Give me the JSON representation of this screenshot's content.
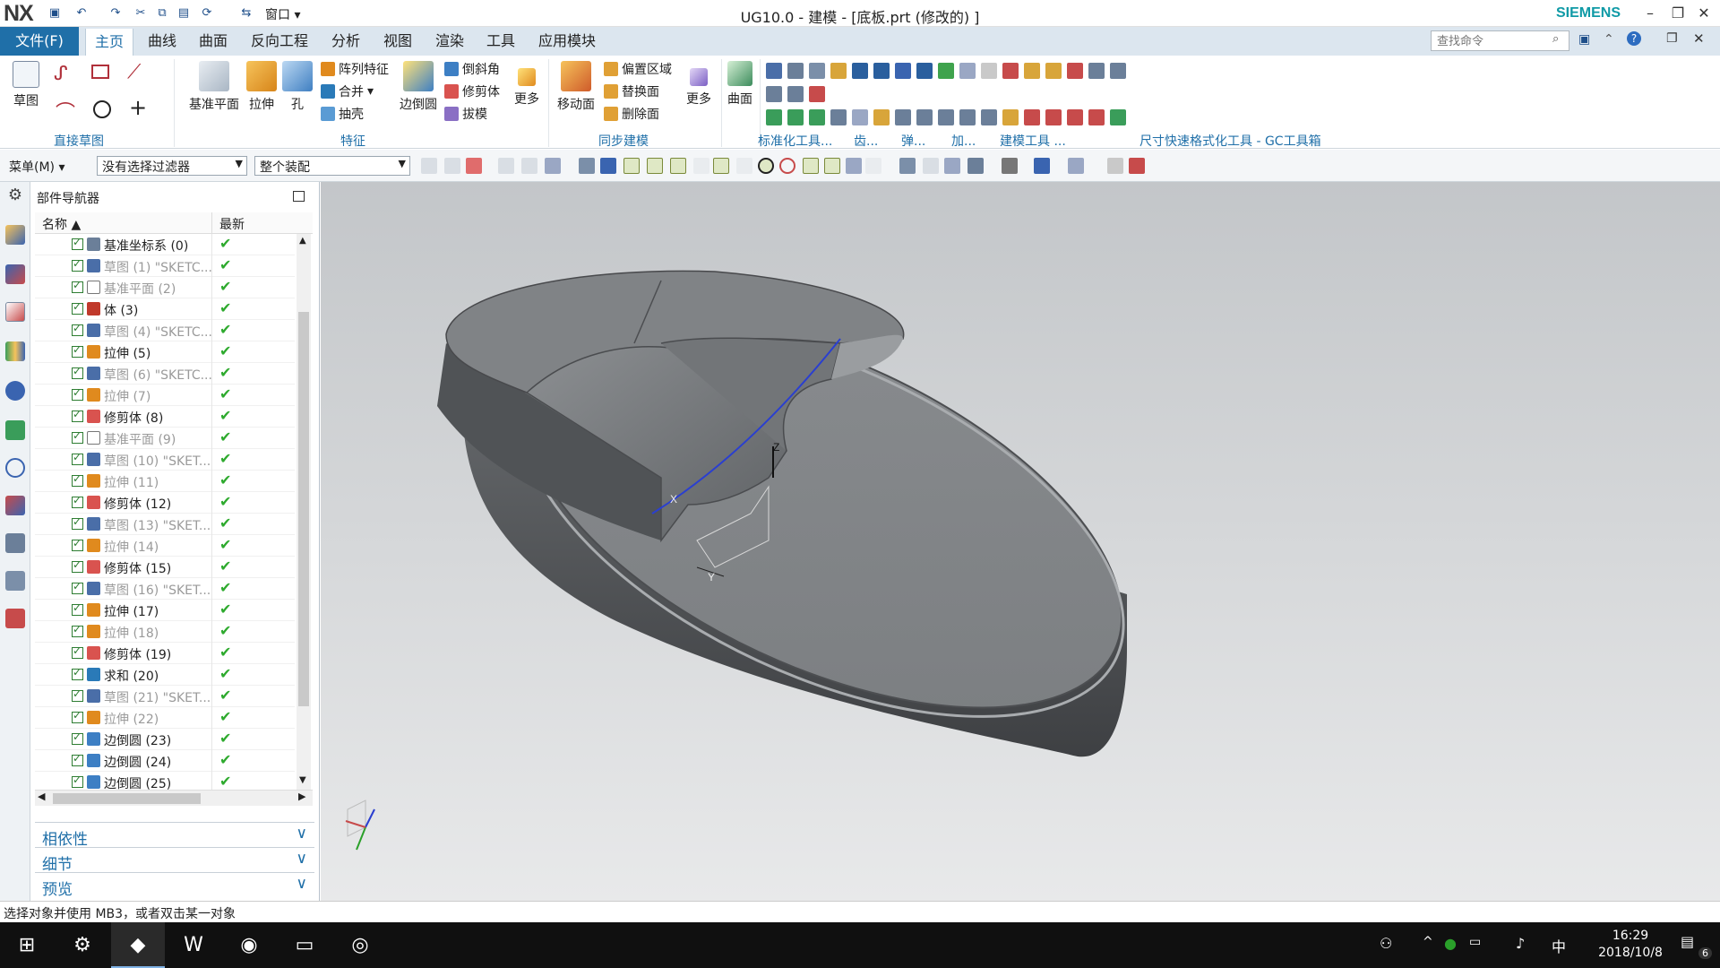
{
  "app": {
    "logo": "NX",
    "title": "UG10.0 - 建模 - [底板.prt  (修改的) ]",
    "brand": "SIEMENS",
    "window_menu": "窗口"
  },
  "ribbon_tabs": {
    "file": "文件(F)",
    "items": [
      "主页",
      "曲线",
      "曲面",
      "反向工程",
      "分析",
      "视图",
      "渲染",
      "工具",
      "应用模块"
    ],
    "search_placeholder": "查找命令"
  },
  "ribbon": {
    "sketch": "草图",
    "datum_plane": "基准平面",
    "extrude": "拉伸",
    "hole": "孔",
    "pattern_feature": "阵列特征",
    "unite": "合并",
    "shell": "抽壳",
    "edge_blend": "边倒圆",
    "chamfer": "倒斜角",
    "trim_body": "修剪体",
    "draft": "拔模",
    "more": "更多",
    "move_face": "移动面",
    "offset_region": "偏置区域",
    "replace_face": "替换面",
    "delete_face": "删除面",
    "more2": "更多",
    "surface": "曲面",
    "groups": {
      "direct_sketch": "直接草图",
      "feature": "特征",
      "sync_modeling": "同步建模",
      "standardization": "标准化工具...",
      "gear": "齿...",
      "spring": "弹...",
      "add": "加...",
      "modeling_tools": "建模工具 ...",
      "dim_tools": "尺寸快速格式化工具 - GC工具箱"
    }
  },
  "cmdbar": {
    "menu": "菜单(M)",
    "filter": "没有选择过滤器",
    "assembly": "整个装配"
  },
  "navigator": {
    "title": "部件导航器",
    "col_name": "名称",
    "col_latest": "最新",
    "items": [
      {
        "name": "基准坐标系 (0)",
        "dim": false,
        "icon": "datum-csys-icon",
        "color": "#6b7f99"
      },
      {
        "name": "草图 (1) \"SKETC...",
        "dim": true,
        "icon": "sketch-icon",
        "color": "#4a6ea8"
      },
      {
        "name": "基准平面 (2)",
        "dim": true,
        "icon": "datum-plane-icon",
        "color": "#ffffff"
      },
      {
        "name": "体 (3)",
        "dim": false,
        "icon": "body-icon",
        "color": "#c0392b"
      },
      {
        "name": "草图 (4) \"SKETC...",
        "dim": true,
        "icon": "sketch-icon",
        "color": "#4a6ea8"
      },
      {
        "name": "拉伸 (5)",
        "dim": false,
        "icon": "extrude-icon",
        "color": "#e08a1e"
      },
      {
        "name": "草图 (6) \"SKETC...",
        "dim": true,
        "icon": "sketch-icon",
        "color": "#4a6ea8"
      },
      {
        "name": "拉伸 (7)",
        "dim": true,
        "icon": "extrude-icon",
        "color": "#e08a1e"
      },
      {
        "name": "修剪体 (8)",
        "dim": false,
        "icon": "trim-body-icon",
        "color": "#d9534f"
      },
      {
        "name": "基准平面 (9)",
        "dim": true,
        "icon": "datum-plane-icon",
        "color": "#ffffff"
      },
      {
        "name": "草图 (10) \"SKET...",
        "dim": true,
        "icon": "sketch-icon",
        "color": "#4a6ea8"
      },
      {
        "name": "拉伸 (11)",
        "dim": true,
        "icon": "extrude-icon",
        "color": "#e08a1e"
      },
      {
        "name": "修剪体 (12)",
        "dim": false,
        "icon": "trim-body-icon",
        "color": "#d9534f"
      },
      {
        "name": "草图 (13) \"SKET...",
        "dim": true,
        "icon": "sketch-icon",
        "color": "#4a6ea8"
      },
      {
        "name": "拉伸 (14)",
        "dim": true,
        "icon": "extrude-icon",
        "color": "#e08a1e"
      },
      {
        "name": "修剪体 (15)",
        "dim": false,
        "icon": "trim-body-icon",
        "color": "#d9534f"
      },
      {
        "name": "草图 (16) \"SKET...",
        "dim": true,
        "icon": "sketch-icon",
        "color": "#4a6ea8"
      },
      {
        "name": "拉伸 (17)",
        "dim": false,
        "icon": "extrude-icon",
        "color": "#e08a1e"
      },
      {
        "name": "拉伸 (18)",
        "dim": true,
        "icon": "extrude-icon",
        "color": "#e08a1e"
      },
      {
        "name": "修剪体 (19)",
        "dim": false,
        "icon": "trim-body-icon",
        "color": "#d9534f"
      },
      {
        "name": "求和 (20)",
        "dim": false,
        "icon": "unite-icon",
        "color": "#2a7ab8"
      },
      {
        "name": "草图 (21) \"SKET...",
        "dim": true,
        "icon": "sketch-icon",
        "color": "#4a6ea8"
      },
      {
        "name": "拉伸 (22)",
        "dim": true,
        "icon": "extrude-icon",
        "color": "#e08a1e"
      },
      {
        "name": "边倒圆 (23)",
        "dim": false,
        "icon": "edge-blend-icon",
        "color": "#3d7fc4"
      },
      {
        "name": "边倒圆 (24)",
        "dim": false,
        "icon": "edge-blend-icon",
        "color": "#3d7fc4"
      },
      {
        "name": "边倒圆 (25)",
        "dim": false,
        "icon": "edge-blend-icon",
        "color": "#3d7fc4"
      }
    ],
    "sections": [
      "相依性",
      "细节",
      "预览"
    ]
  },
  "viewport": {
    "axis_x": "X",
    "axis_y": "Y",
    "axis_z": "Z"
  },
  "status": "选择对象并使用 MB3，或者双击某一对象",
  "taskbar": {
    "time": "16:29",
    "date": "2018/10/8",
    "ime": "中",
    "notify_count": "6"
  },
  "colors": {
    "accent": "#1f6fa8",
    "siemens": "#0f9aa6",
    "check": "#2eaa2e"
  }
}
